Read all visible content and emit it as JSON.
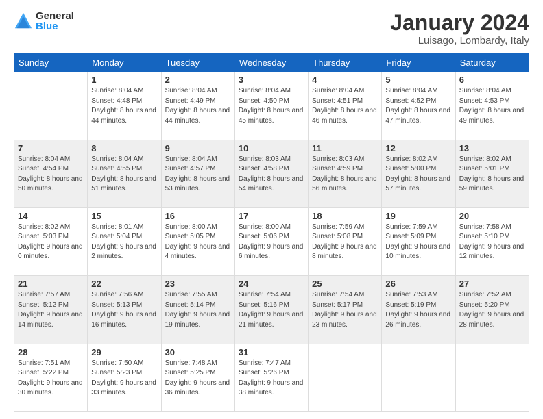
{
  "header": {
    "logo_general": "General",
    "logo_blue": "Blue",
    "month_title": "January 2024",
    "location": "Luisago, Lombardy, Italy"
  },
  "weekdays": [
    "Sunday",
    "Monday",
    "Tuesday",
    "Wednesday",
    "Thursday",
    "Friday",
    "Saturday"
  ],
  "weeks": [
    [
      {
        "day": "",
        "sunrise": "",
        "sunset": "",
        "daylight": ""
      },
      {
        "day": "1",
        "sunrise": "Sunrise: 8:04 AM",
        "sunset": "Sunset: 4:48 PM",
        "daylight": "Daylight: 8 hours and 44 minutes."
      },
      {
        "day": "2",
        "sunrise": "Sunrise: 8:04 AM",
        "sunset": "Sunset: 4:49 PM",
        "daylight": "Daylight: 8 hours and 44 minutes."
      },
      {
        "day": "3",
        "sunrise": "Sunrise: 8:04 AM",
        "sunset": "Sunset: 4:50 PM",
        "daylight": "Daylight: 8 hours and 45 minutes."
      },
      {
        "day": "4",
        "sunrise": "Sunrise: 8:04 AM",
        "sunset": "Sunset: 4:51 PM",
        "daylight": "Daylight: 8 hours and 46 minutes."
      },
      {
        "day": "5",
        "sunrise": "Sunrise: 8:04 AM",
        "sunset": "Sunset: 4:52 PM",
        "daylight": "Daylight: 8 hours and 47 minutes."
      },
      {
        "day": "6",
        "sunrise": "Sunrise: 8:04 AM",
        "sunset": "Sunset: 4:53 PM",
        "daylight": "Daylight: 8 hours and 49 minutes."
      }
    ],
    [
      {
        "day": "7",
        "sunrise": "Sunrise: 8:04 AM",
        "sunset": "Sunset: 4:54 PM",
        "daylight": "Daylight: 8 hours and 50 minutes."
      },
      {
        "day": "8",
        "sunrise": "Sunrise: 8:04 AM",
        "sunset": "Sunset: 4:55 PM",
        "daylight": "Daylight: 8 hours and 51 minutes."
      },
      {
        "day": "9",
        "sunrise": "Sunrise: 8:04 AM",
        "sunset": "Sunset: 4:57 PM",
        "daylight": "Daylight: 8 hours and 53 minutes."
      },
      {
        "day": "10",
        "sunrise": "Sunrise: 8:03 AM",
        "sunset": "Sunset: 4:58 PM",
        "daylight": "Daylight: 8 hours and 54 minutes."
      },
      {
        "day": "11",
        "sunrise": "Sunrise: 8:03 AM",
        "sunset": "Sunset: 4:59 PM",
        "daylight": "Daylight: 8 hours and 56 minutes."
      },
      {
        "day": "12",
        "sunrise": "Sunrise: 8:02 AM",
        "sunset": "Sunset: 5:00 PM",
        "daylight": "Daylight: 8 hours and 57 minutes."
      },
      {
        "day": "13",
        "sunrise": "Sunrise: 8:02 AM",
        "sunset": "Sunset: 5:01 PM",
        "daylight": "Daylight: 8 hours and 59 minutes."
      }
    ],
    [
      {
        "day": "14",
        "sunrise": "Sunrise: 8:02 AM",
        "sunset": "Sunset: 5:03 PM",
        "daylight": "Daylight: 9 hours and 0 minutes."
      },
      {
        "day": "15",
        "sunrise": "Sunrise: 8:01 AM",
        "sunset": "Sunset: 5:04 PM",
        "daylight": "Daylight: 9 hours and 2 minutes."
      },
      {
        "day": "16",
        "sunrise": "Sunrise: 8:00 AM",
        "sunset": "Sunset: 5:05 PM",
        "daylight": "Daylight: 9 hours and 4 minutes."
      },
      {
        "day": "17",
        "sunrise": "Sunrise: 8:00 AM",
        "sunset": "Sunset: 5:06 PM",
        "daylight": "Daylight: 9 hours and 6 minutes."
      },
      {
        "day": "18",
        "sunrise": "Sunrise: 7:59 AM",
        "sunset": "Sunset: 5:08 PM",
        "daylight": "Daylight: 9 hours and 8 minutes."
      },
      {
        "day": "19",
        "sunrise": "Sunrise: 7:59 AM",
        "sunset": "Sunset: 5:09 PM",
        "daylight": "Daylight: 9 hours and 10 minutes."
      },
      {
        "day": "20",
        "sunrise": "Sunrise: 7:58 AM",
        "sunset": "Sunset: 5:10 PM",
        "daylight": "Daylight: 9 hours and 12 minutes."
      }
    ],
    [
      {
        "day": "21",
        "sunrise": "Sunrise: 7:57 AM",
        "sunset": "Sunset: 5:12 PM",
        "daylight": "Daylight: 9 hours and 14 minutes."
      },
      {
        "day": "22",
        "sunrise": "Sunrise: 7:56 AM",
        "sunset": "Sunset: 5:13 PM",
        "daylight": "Daylight: 9 hours and 16 minutes."
      },
      {
        "day": "23",
        "sunrise": "Sunrise: 7:55 AM",
        "sunset": "Sunset: 5:14 PM",
        "daylight": "Daylight: 9 hours and 19 minutes."
      },
      {
        "day": "24",
        "sunrise": "Sunrise: 7:54 AM",
        "sunset": "Sunset: 5:16 PM",
        "daylight": "Daylight: 9 hours and 21 minutes."
      },
      {
        "day": "25",
        "sunrise": "Sunrise: 7:54 AM",
        "sunset": "Sunset: 5:17 PM",
        "daylight": "Daylight: 9 hours and 23 minutes."
      },
      {
        "day": "26",
        "sunrise": "Sunrise: 7:53 AM",
        "sunset": "Sunset: 5:19 PM",
        "daylight": "Daylight: 9 hours and 26 minutes."
      },
      {
        "day": "27",
        "sunrise": "Sunrise: 7:52 AM",
        "sunset": "Sunset: 5:20 PM",
        "daylight": "Daylight: 9 hours and 28 minutes."
      }
    ],
    [
      {
        "day": "28",
        "sunrise": "Sunrise: 7:51 AM",
        "sunset": "Sunset: 5:22 PM",
        "daylight": "Daylight: 9 hours and 30 minutes."
      },
      {
        "day": "29",
        "sunrise": "Sunrise: 7:50 AM",
        "sunset": "Sunset: 5:23 PM",
        "daylight": "Daylight: 9 hours and 33 minutes."
      },
      {
        "day": "30",
        "sunrise": "Sunrise: 7:48 AM",
        "sunset": "Sunset: 5:25 PM",
        "daylight": "Daylight: 9 hours and 36 minutes."
      },
      {
        "day": "31",
        "sunrise": "Sunrise: 7:47 AM",
        "sunset": "Sunset: 5:26 PM",
        "daylight": "Daylight: 9 hours and 38 minutes."
      },
      {
        "day": "",
        "sunrise": "",
        "sunset": "",
        "daylight": ""
      },
      {
        "day": "",
        "sunrise": "",
        "sunset": "",
        "daylight": ""
      },
      {
        "day": "",
        "sunrise": "",
        "sunset": "",
        "daylight": ""
      }
    ]
  ]
}
